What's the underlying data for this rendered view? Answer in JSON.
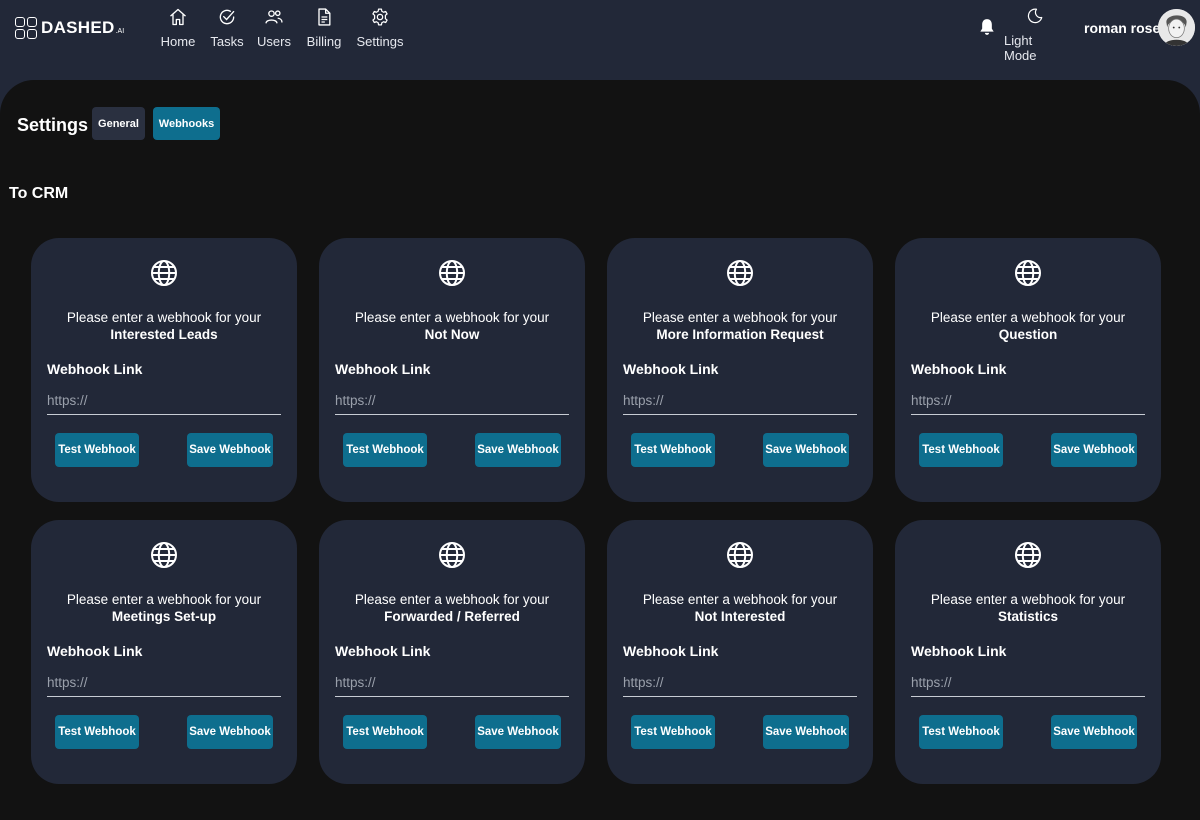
{
  "brand": {
    "name": "DASHED",
    "suffix": ".AI"
  },
  "nav": {
    "items": [
      {
        "label": "Home",
        "icon": "home-icon"
      },
      {
        "label": "Tasks",
        "icon": "check-circle-icon"
      },
      {
        "label": "Users",
        "icon": "users-icon"
      },
      {
        "label": "Billing",
        "icon": "document-icon"
      },
      {
        "label": "Settings",
        "icon": "gear-icon"
      }
    ],
    "theme_label": "Light Mode",
    "user_name": "roman rose"
  },
  "page": {
    "title": "Settings",
    "tabs": [
      {
        "label": "General",
        "active": false
      },
      {
        "label": "Webhooks",
        "active": true
      }
    ],
    "section_title": "To CRM"
  },
  "cards": [
    {
      "prompt": "Please enter a webhook for your",
      "category": "Interested Leads",
      "link_label": "Webhook Link",
      "placeholder": "https://",
      "value": "",
      "test_label": "Test Webhook",
      "save_label": "Save Webhook"
    },
    {
      "prompt": "Please enter a webhook for your",
      "category": "Not Now",
      "link_label": "Webhook Link",
      "placeholder": "https://",
      "value": "",
      "test_label": "Test Webhook",
      "save_label": "Save Webhook"
    },
    {
      "prompt": "Please enter a webhook for your",
      "category": "More Information Request",
      "link_label": "Webhook Link",
      "placeholder": "https://",
      "value": "",
      "test_label": "Test Webhook",
      "save_label": "Save Webhook"
    },
    {
      "prompt": "Please enter a webhook for your",
      "category": "Question",
      "link_label": "Webhook Link",
      "placeholder": "https://",
      "value": "",
      "test_label": "Test Webhook",
      "save_label": "Save Webhook"
    },
    {
      "prompt": "Please enter a webhook for your",
      "category": "Meetings Set-up",
      "link_label": "Webhook Link",
      "placeholder": "https://",
      "value": "",
      "test_label": "Test Webhook",
      "save_label": "Save Webhook"
    },
    {
      "prompt": "Please enter a webhook for your",
      "category": "Forwarded / Referred",
      "link_label": "Webhook Link",
      "placeholder": "https://",
      "value": "",
      "test_label": "Test Webhook",
      "save_label": "Save Webhook"
    },
    {
      "prompt": "Please enter a webhook for your",
      "category": "Not Interested",
      "link_label": "Webhook Link",
      "placeholder": "https://",
      "value": "",
      "test_label": "Test Webhook",
      "save_label": "Save Webhook"
    },
    {
      "prompt": "Please enter a webhook for your",
      "category": "Statistics",
      "link_label": "Webhook Link",
      "placeholder": "https://",
      "value": "",
      "test_label": "Test Webhook",
      "save_label": "Save Webhook"
    }
  ],
  "colors": {
    "background": "#222838",
    "panel": "#121212",
    "card": "#222838",
    "accent": "#0e6e8e"
  }
}
